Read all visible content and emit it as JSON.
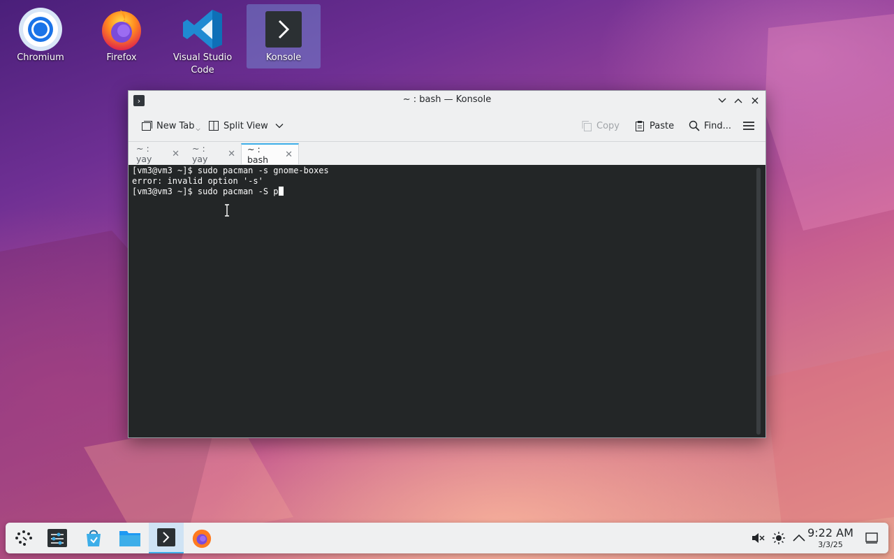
{
  "desktop": {
    "icons": [
      {
        "label": "Chromium"
      },
      {
        "label": "Firefox"
      },
      {
        "label": "Visual Studio Code"
      },
      {
        "label": "Konsole"
      }
    ]
  },
  "window": {
    "title": "~ : bash — Konsole",
    "toolbar": {
      "new_tab": "New Tab",
      "split_view": "Split View",
      "copy": "Copy",
      "paste": "Paste",
      "find": "Find..."
    },
    "tabs": [
      {
        "label": "~ : yay"
      },
      {
        "label": "~ : yay"
      },
      {
        "label": "~ : bash"
      }
    ],
    "terminal_lines": [
      "[vm3@vm3 ~]$ sudo pacman -s gnome-boxes",
      "error: invalid option '-s'",
      "[vm3@vm3 ~]$ sudo pacman -S p"
    ]
  },
  "taskbar": {
    "clock_time": "9:22 AM",
    "clock_date": "3/3/25"
  },
  "colors": {
    "accent": "#3daee9",
    "terminal_bg": "#232627",
    "window_bg": "#eff0f1"
  }
}
